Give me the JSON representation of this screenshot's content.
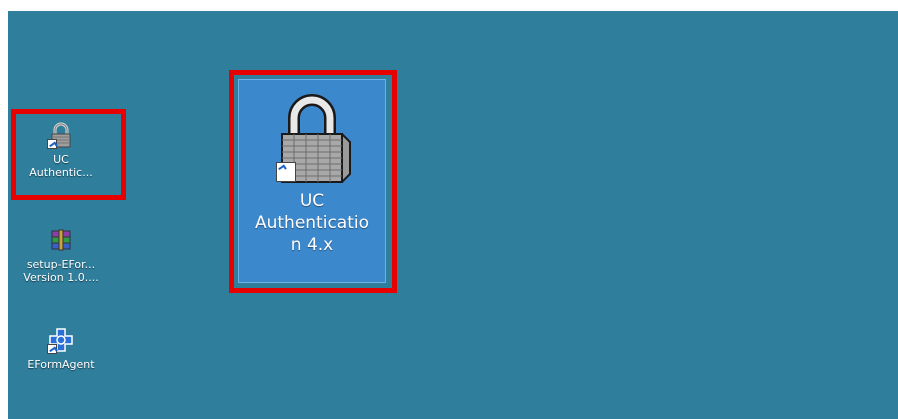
{
  "desktop": {
    "background_color": "#2f7e9c",
    "icons": [
      {
        "label": "UC\nAuthentic...",
        "icon": "padlock-icon"
      },
      {
        "label": "setup-EFor...\nVersion 1.0....",
        "icon": "winrar-archive-icon"
      },
      {
        "label": "EFormAgent",
        "icon": "eform-agent-icon"
      }
    ],
    "selected_icon": {
      "label": "UC\nAuthenticatio\nn 4.x",
      "icon": "padlock-icon"
    },
    "highlight_color": "#e60000"
  }
}
